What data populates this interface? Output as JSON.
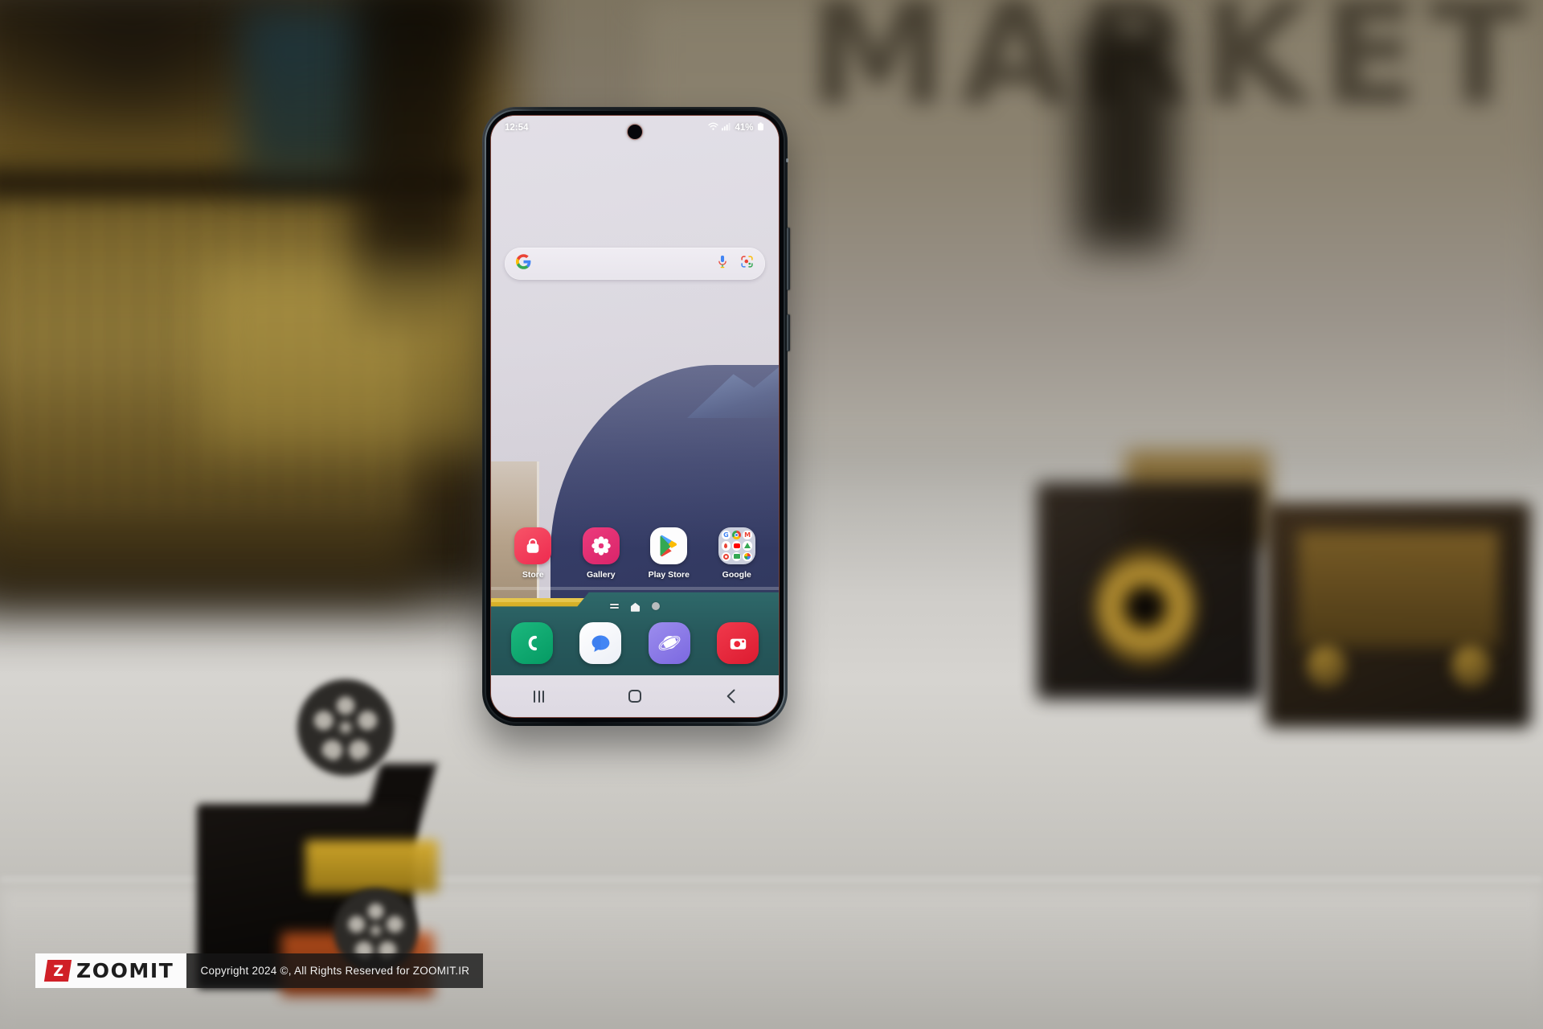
{
  "scene": {
    "background_text": "MARKET",
    "colors": {
      "wall": "#8b8270",
      "table": "#cfcdc9",
      "phone_frame": "#20262b",
      "screen_bg": "#d9d5dd"
    }
  },
  "phone": {
    "status_bar": {
      "time": "12:54",
      "battery_percent": "41%",
      "icons": [
        "wifi-icon",
        "signal-bars-icon",
        "battery-icon"
      ]
    },
    "search": {
      "placeholder": "",
      "value": "",
      "google_logo": "google-g-icon",
      "mic": "microphone-icon",
      "lens": "google-lens-icon"
    },
    "apps": [
      {
        "label": "Store",
        "icon": "galaxy-store-icon",
        "bg": "#f2395a"
      },
      {
        "label": "Gallery",
        "icon": "gallery-flower-icon",
        "bg": "#e0316f"
      },
      {
        "label": "Play Store",
        "icon": "play-store-icon",
        "bg": "#ffffff"
      },
      {
        "label": "Google",
        "icon": "google-folder-icon",
        "bg": "#ccd0dd"
      }
    ],
    "google_folder_apps": [
      "google-search-icon",
      "chrome-icon",
      "gmail-icon",
      "maps-icon",
      "youtube-icon",
      "drive-icon",
      "photos-shutter-icon",
      "meet-icon",
      "google-photos-icon"
    ],
    "page_indicator": {
      "items": [
        "widgets-lines-icon",
        "home-house-icon",
        "page-dot"
      ],
      "current": 1
    },
    "dock": [
      {
        "label": "Phone",
        "icon": "phone-handset-icon",
        "bg": "#0fa470"
      },
      {
        "label": "Messages",
        "icon": "messages-bubble-icon",
        "bg": "#f3f4f8"
      },
      {
        "label": "Samsung Internet",
        "icon": "internet-planet-icon",
        "bg": "#8b7ce8"
      },
      {
        "label": "Camera",
        "icon": "camera-icon",
        "bg": "#e8273c"
      }
    ],
    "navigation": [
      {
        "label": "Recents",
        "icon": "recents-icon"
      },
      {
        "label": "Home",
        "icon": "home-square-icon"
      },
      {
        "label": "Back",
        "icon": "back-chevron-icon"
      }
    ]
  },
  "watermark": {
    "logo_mark": "Z",
    "brand": "ZOOMIT",
    "copyright": "Copyright 2024 ©, All Rights Reserved for ZOOMIT.IR"
  }
}
